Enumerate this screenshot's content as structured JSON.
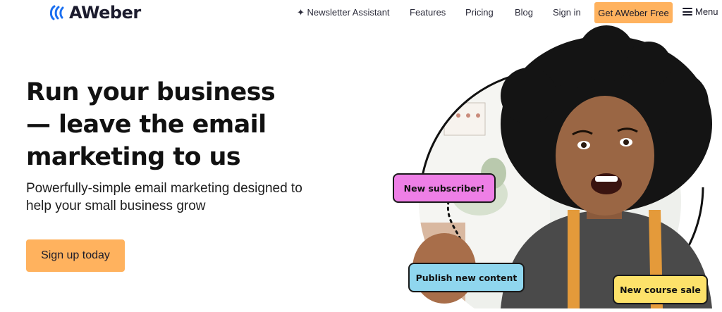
{
  "brand": {
    "name": "AWeber",
    "accent": "#ffb25e"
  },
  "nav": {
    "assistant": "✦ Newsletter Assistant",
    "features": "Features",
    "pricing": "Pricing",
    "blog": "Blog",
    "signin": "Sign in",
    "cta": "Get AWeber Free",
    "menu": "Menu"
  },
  "hero": {
    "headline": "Run your business\n— leave the email\nmarketing to us",
    "subhead": "Powerfully-simple email marketing designed to help your small business grow",
    "button": "Sign up today"
  },
  "tags": {
    "subscriber": {
      "label": "New subscriber!",
      "color": "#ee7fe6"
    },
    "publish": {
      "label": "Publish new content",
      "color": "#8fd6ee"
    },
    "sale": {
      "label": "New course sale",
      "color": "#fde26a"
    }
  }
}
